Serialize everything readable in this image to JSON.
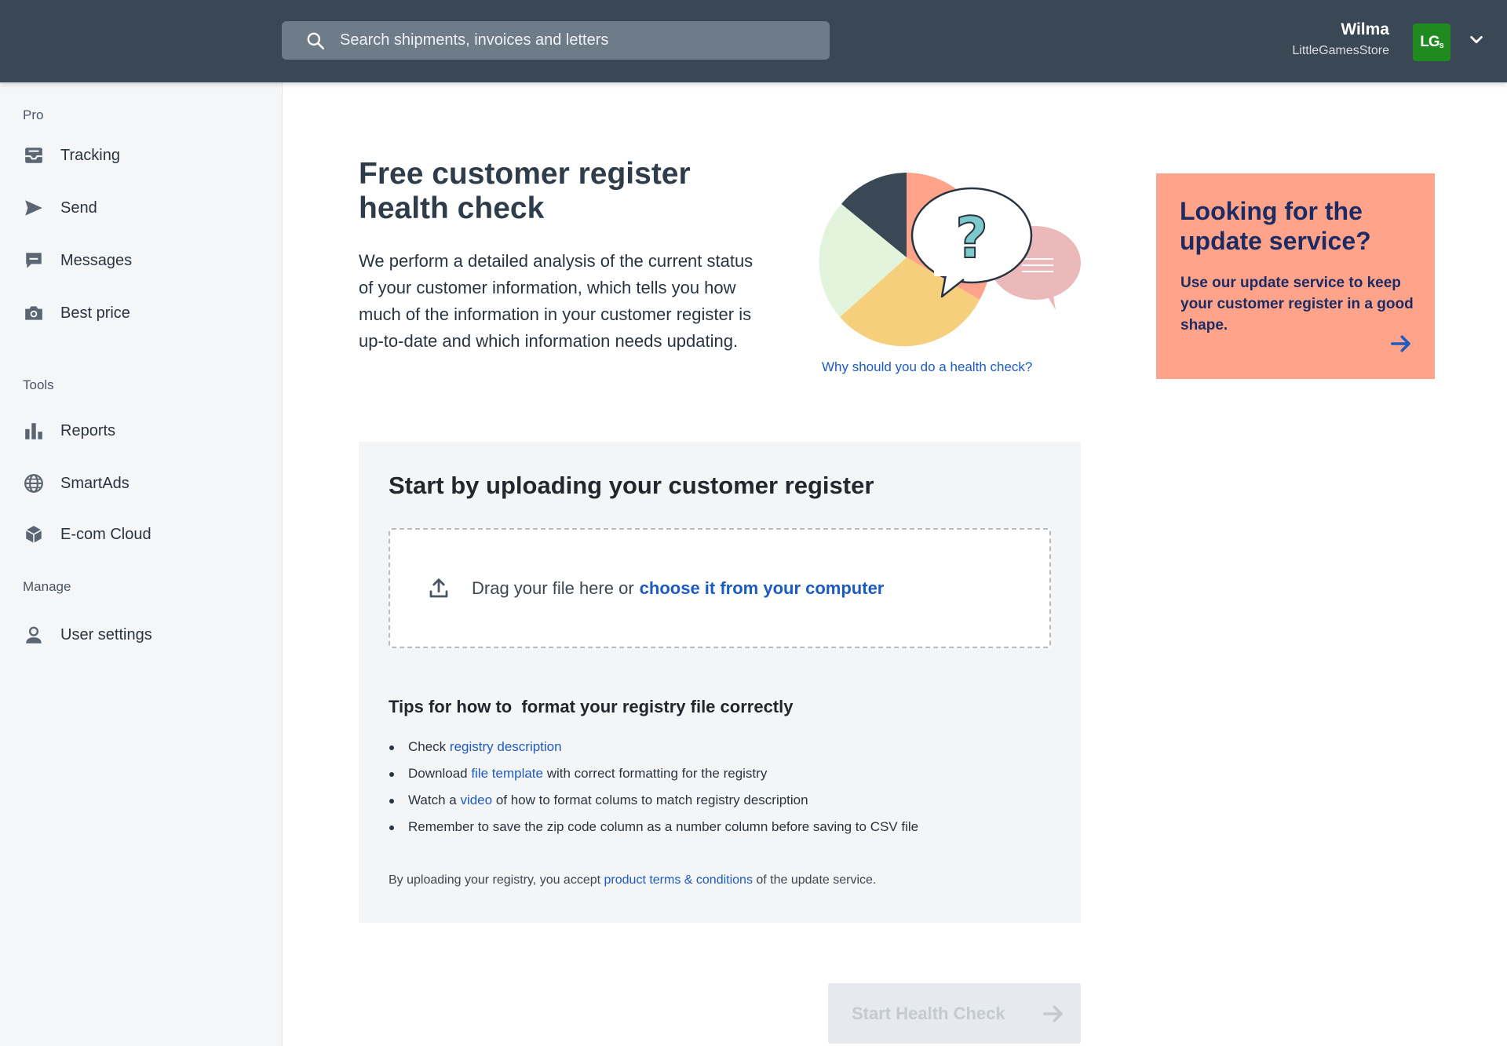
{
  "header": {
    "search_placeholder": "Search shipments, invoices and letters",
    "user_name": "Wilma",
    "company": "LittleGamesStore",
    "avatar_text": "LG",
    "avatar_sub": "s",
    "avatar_color": "#1f8a1f",
    "background": "#3a4856"
  },
  "sidebar": {
    "sections": [
      {
        "label": "Pro",
        "items": [
          {
            "label": "Tracking",
            "icon": "inbox-tray-icon"
          },
          {
            "label": "Send",
            "icon": "paper-plane-icon"
          },
          {
            "label": "Messages",
            "icon": "chat-bubble-icon"
          },
          {
            "label": "Best price",
            "icon": "camera-icon"
          }
        ]
      },
      {
        "label": "Tools",
        "items": [
          {
            "label": "Reports",
            "icon": "bar-chart-icon"
          },
          {
            "label": "SmartAds",
            "icon": "globe-icon"
          },
          {
            "label": "E-com Cloud",
            "icon": "cube-icon"
          }
        ]
      },
      {
        "label": "Manage",
        "items": [
          {
            "label": "User settings",
            "icon": "user-icon"
          }
        ]
      }
    ]
  },
  "hero": {
    "title": "Free customer register health check",
    "description": "We perform a detailed analysis of the current status of your customer information, which tells you how much of the information in your customer register is up-to-date and which information needs updating.",
    "why_link": "Why should you do a health check?",
    "illustration": "pie-chart-with-speech-bubbles"
  },
  "promo": {
    "title": "Looking for the update service?",
    "text": "Use our update service to keep your customer register in a good shape.",
    "background": "#ffa38b",
    "text_color": "#1c2b62"
  },
  "upload": {
    "title": "Start by uploading your customer register",
    "drop_text": "Drag your file here or",
    "drop_link": "choose it from your computer",
    "tips_title": "Tips for how to  format your registry file correctly",
    "tips": [
      {
        "before": "Check ",
        "link": "registry description",
        "after": ""
      },
      {
        "before": "Download ",
        "link": "file template",
        "after": " with correct formatting for the registry"
      },
      {
        "before": "Watch a ",
        "link": "video",
        "after": " of how to format colums to match registry description"
      },
      {
        "before": "Remember to save the zip code column as a number column before saving to CSV file",
        "link": "",
        "after": ""
      }
    ],
    "terms_before": "By uploading your registry, you accept ",
    "terms_link": "product terms & conditions",
    "terms_after": " of the update service."
  },
  "actions": {
    "start_label": "Start Health Check",
    "start_disabled": true
  },
  "colors": {
    "link": "#1d5bbf",
    "sidebar_bg": "#f5f6f8",
    "card_bg": "#f4f5f7"
  }
}
